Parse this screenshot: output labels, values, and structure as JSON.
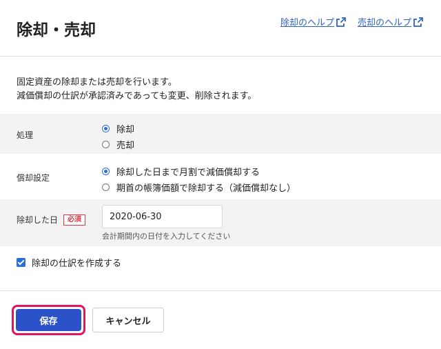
{
  "header": {
    "title": "除却・売却",
    "links": [
      {
        "label": "除却のヘルプ",
        "icon": "external-link-icon"
      },
      {
        "label": "売却のヘルプ",
        "icon": "external-link-icon"
      }
    ]
  },
  "description": {
    "line1": "固定資産の除却または売却を行います。",
    "line2": "減価償却の仕訳が承認済みであっても変更、削除されます。"
  },
  "form": {
    "processing": {
      "label": "処理",
      "options": [
        {
          "label": "除却",
          "selected": true
        },
        {
          "label": "売却",
          "selected": false
        }
      ]
    },
    "depreciation": {
      "label": "償却設定",
      "options": [
        {
          "label": "除却した日まで月割で減価償却する",
          "selected": true
        },
        {
          "label": "期首の帳簿価額で除却する（減価償却なし）",
          "selected": false
        }
      ]
    },
    "disposal_date": {
      "label": "除却した日",
      "required_badge": "必須",
      "value": "2020-06-30",
      "hint": "会計期間内の日付を入力してください"
    },
    "create_entry": {
      "label": "除却の仕訳を作成する",
      "checked": true
    }
  },
  "footer": {
    "save_label": "保存",
    "cancel_label": "キャンセル"
  },
  "colors": {
    "primary": "#2b52c8",
    "link": "#2f62c5",
    "required": "#d9394a",
    "highlight_border": "#e0155b",
    "row_bg": "#f3f3f3"
  }
}
